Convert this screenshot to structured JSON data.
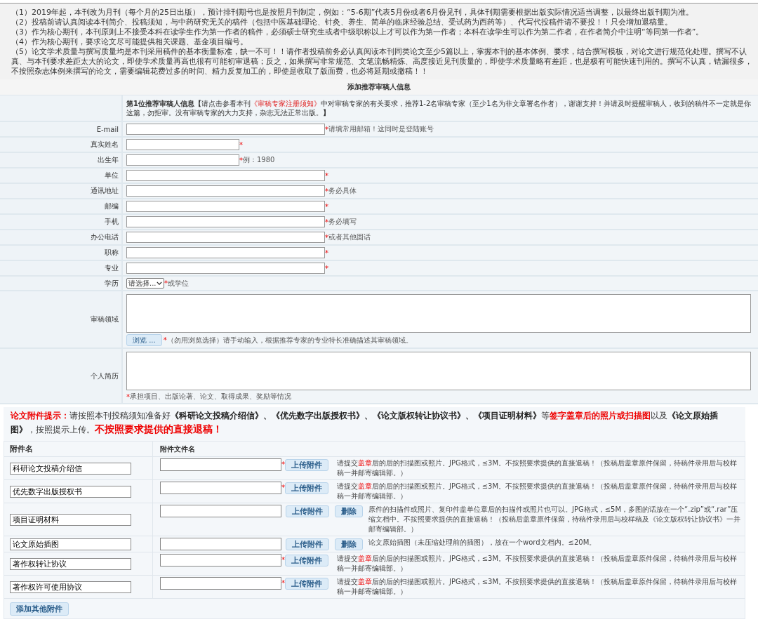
{
  "notices": [
    "（1）2019年起，本刊改为月刊（每个月的25日出版），预计排刊期号也是按照月刊制定，例如：“5-6期”代表5月份或者6月份见刊，具体刊期需要根据出版实际情况适当调整，以最终出版刊期为准。",
    "（2）投稿前请认真阅读本刊简介、投稿须知，与中药研究无关的稿件（包括中医基础理论、针灸、养生、简单的临床经验总结、受试药为西药等）、代写代投稿件请不要投！！只会增加退稿量。",
    "（3）作为核心期刊，本刊原则上不接受本科在读学生作为第一作者的稿件，必须硕士研究生或者中级职称以上才可以作为第一作者；本科在读学生可以作为第二作者，在作者简介中注明“等同第一作者”。",
    "（4）作为核心期刊，要求论文尽可能提供相关课题、基金项目编号。",
    "（5）论文学术质量与撰写质量均是本刊采用稿件的基本衡量标准，缺一不可！！请作者投稿前务必认真阅读本刊同类论文至少5篇以上，掌握本刊的基本体例、要求，结合撰写模板，对论文进行规范化处理。撰写不认真、与本刊要求差距太大的论文，即使学术质量再高也很有可能初审退稿；反之，如果撰写非常规范、文笔流畅精炼、高度接近见刊质量的，即使学术质量略有差距，也是极有可能快速刊用的。撰写不认真，错漏很多，不按照杂志体例来撰写的论文，需要编辑花费过多的时间、精力反复加工的，即使是收取了版面费，也必将延期或撤稿！！"
  ],
  "reviewer": {
    "title": "添加推荐审稿人信息",
    "intro_prefix": "**第1位推荐审稿人信息【**请点击参看本刊",
    "intro_link": "《审稿专家注册须知》",
    "intro_suffix": "中对审稿专家的有关要求，推荐1-2名审稿专家（至少1名为非文章署名作者），谢谢支持！并请及时提醒审稿人，收到的稿件不一定就是你这篇，勿拒审。没有审稿专家的大力支持，杂志无法正常出版。**】**",
    "fields": [
      {
        "label": "E-mail",
        "kind": "input",
        "required_mark": "*",
        "hint": "请填常用邮箱！这同时是登陆账号"
      },
      {
        "label": "真实姓名",
        "kind": "short_input",
        "required_mark": "*"
      },
      {
        "label": "出生年",
        "kind": "short_input",
        "required_mark": "*",
        "hint": "例：1980"
      },
      {
        "label": "单位",
        "kind": "input",
        "required_mark": "*"
      },
      {
        "label": "通讯地址",
        "kind": "input",
        "required_mark": "*",
        "hint": "务必具体"
      },
      {
        "label": "邮编",
        "kind": "input",
        "required_mark": "*"
      },
      {
        "label": "手机",
        "kind": "input",
        "required_mark": "*",
        "hint": "务必填写"
      },
      {
        "label": "办公电话",
        "kind": "input",
        "required_mark": "*",
        "hint": "或者其他固话"
      },
      {
        "label": "职称",
        "kind": "input",
        "required_mark": "*"
      },
      {
        "label": "专业",
        "kind": "input",
        "required_mark": "*"
      },
      {
        "label": "学历",
        "kind": "select",
        "value": "请选择...",
        "required_mark": "*",
        "hint": "或学位"
      },
      {
        "label": "审稿领域",
        "kind": "textarea",
        "button": "浏览 ...",
        "required_mark": "*",
        "hint": "（勿用浏览选择）请手动输入，根据推荐专家的专业特长准确描述其审稿领域。"
      },
      {
        "label": "个人简历",
        "kind": "textarea",
        "required_mark": "*",
        "hint": "承担项目、出版论著、论文、取得成果、奖励等情况"
      }
    ]
  },
  "attachments": {
    "notice": [
      {
        "kind": "label",
        "text": "论文附件提示："
      },
      {
        "kind": "plain",
        "text": "请按照本刊投稿须知准备好"
      },
      {
        "kind": "bold",
        "text": "《科研论文投稿介绍信》、《优先数字出版授权书》、《论文版权转让协议书》、《项目证明材料》"
      },
      {
        "kind": "plain",
        "text": "等"
      },
      {
        "kind": "alert",
        "text": "签字盖章后的照片或扫描图"
      },
      {
        "kind": "plain",
        "text": "以及"
      },
      {
        "kind": "bold",
        "text": "《论文原始插图》"
      },
      {
        "kind": "plain",
        "text": "，按照提示上传。"
      },
      {
        "kind": "warning",
        "text": "不按照要求提供的直接退稿！"
      }
    ],
    "columns": [
      "附件名",
      "附件文件名"
    ],
    "rows": [
      {
        "name": "科研论文投稿介绍信",
        "required_mark": "*",
        "upload": "上传附件",
        "note": [
          {
            "kind": "plain",
            "text": "请提交"
          },
          {
            "kind": "alert",
            "text": "盖章"
          },
          {
            "kind": "plain",
            "text": "后的后的扫描图或照片。JPG格式，≤3M。不按照要求提供的直接退稿！（投稿后盖章原件保留，待稿件录用后与校样稿一并邮寄编辑部。）"
          }
        ]
      },
      {
        "name": "优先数字出版授权书",
        "required_mark": "*",
        "upload": "上传附件",
        "note": [
          {
            "kind": "plain",
            "text": "请提交"
          },
          {
            "kind": "alert",
            "text": "盖章"
          },
          {
            "kind": "plain",
            "text": "后的后的扫描图或照片。JPG格式，≤3M。不按照要求提供的直接退稿！（投稿后盖章原件保留，待稿件录用后与校样稿一并邮寄编辑部。）"
          }
        ]
      },
      {
        "name": "项目证明材料",
        "upload": "上传附件",
        "delete": "删除",
        "note": [
          {
            "kind": "plain",
            "text": "原件的扫描件或照片、复印件盖单位章后的扫描件或照片也可以。JPG格式，≤5M，多图的话放在一个“.zip”或“.rar”压缩文档中。不按照要求提供的直接退稿！（投稿后盖章原件保留，待稿件录用后与校样稿及《论文版权转让协议书》一并邮寄编辑部。）"
          }
        ]
      },
      {
        "name": "论文原始插图",
        "upload": "上传附件",
        "delete": "删除",
        "note": [
          {
            "kind": "plain",
            "text": "论文原始插图（未压缩处理前的插图），放在一个word文档内。≤20M。"
          }
        ]
      },
      {
        "name": "著作权转让协议",
        "required_mark": "*",
        "upload": "上传附件",
        "note": [
          {
            "kind": "plain",
            "text": "请提交"
          },
          {
            "kind": "alert",
            "text": "盖章"
          },
          {
            "kind": "plain",
            "text": "后的后的扫描图或照片。JPG格式，≤3M。不按照要求提供的直接退稿！（投稿后盖章原件保留，待稿件录用后与校样稿一并邮寄编辑部。）"
          }
        ]
      },
      {
        "name": "著作权许可使用协议",
        "required_mark": "*",
        "upload": "上传附件",
        "note": [
          {
            "kind": "plain",
            "text": "请提交"
          },
          {
            "kind": "alert",
            "text": "盖章"
          },
          {
            "kind": "plain",
            "text": "后的后的扫描图或照片。JPG格式，≤3M。不按照要求提供的直接退稿！（投稿后盖章原件保留，待稿件录用后与校样稿一并邮寄编辑部。）"
          }
        ]
      }
    ],
    "add_button": "添加其他附件"
  }
}
